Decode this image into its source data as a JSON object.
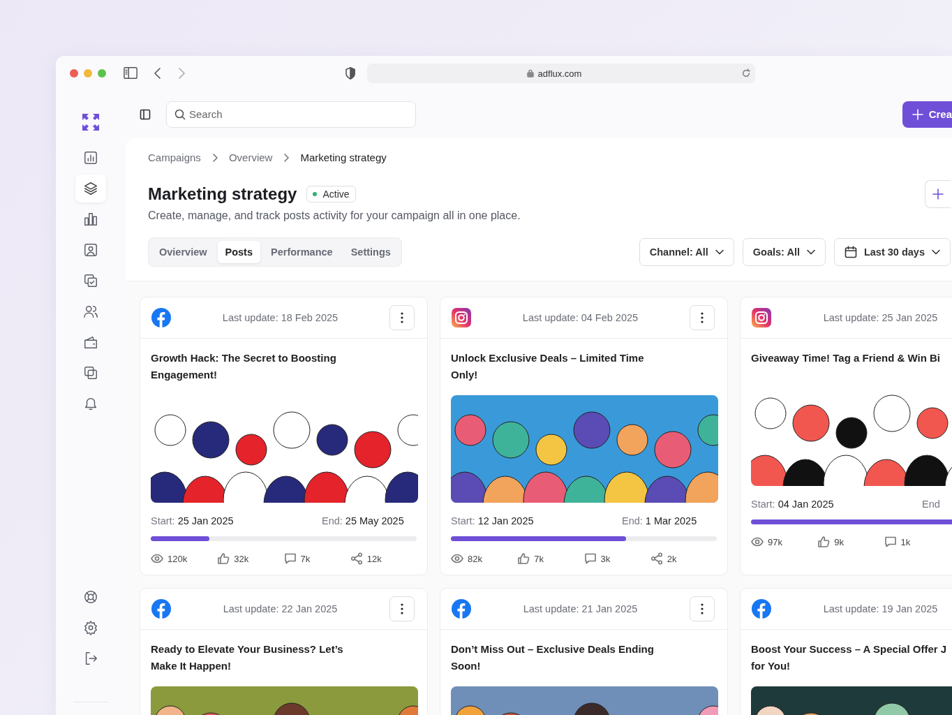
{
  "browser": {
    "url": "adflux.com"
  },
  "nav_items": [
    {
      "selected": false
    },
    {
      "selected": true
    },
    {
      "selected": false
    },
    {
      "selected": false
    },
    {
      "selected": false
    },
    {
      "selected": false
    },
    {
      "selected": false
    },
    {
      "selected": false
    },
    {
      "selected": false
    }
  ],
  "nav_bottom": [
    {
      "selected": false
    },
    {
      "selected": false
    },
    {
      "selected": false
    }
  ],
  "search": {
    "placeholder": "Search"
  },
  "create_button": "Crea",
  "breadcrumb": [
    "Campaigns",
    "Overview",
    "Marketing strategy"
  ],
  "page": {
    "title": "Marketing strategy",
    "status": "Active",
    "subtitle": "Create, manage, and track posts activity for your campaign all in one place."
  },
  "tabs": [
    {
      "label": "Ovierview",
      "selected": false
    },
    {
      "label": "Posts",
      "selected": true
    },
    {
      "label": "Performance",
      "selected": false
    },
    {
      "label": "Settings",
      "selected": false
    }
  ],
  "filters": [
    {
      "label": "Channel: All",
      "kind": "dropdown"
    },
    {
      "label": "Goals: All",
      "kind": "dropdown"
    },
    {
      "label": "Last 30 days",
      "kind": "date"
    }
  ],
  "cards": [
    {
      "kind": "facebook",
      "updated": "Last update: 18 Feb 2025",
      "menu": true,
      "title_lines": [
        "Growth Hack: The Secret to Boosting",
        "Engagement!"
      ],
      "start_label": "Start:",
      "start": "25 Jan 2025",
      "end_label": "End:",
      "end": "25 May 2025",
      "level": 0.22,
      "stats": [
        {
          "kind": "views",
          "value": "120k"
        },
        {
          "kind": "likes",
          "value": "32k"
        },
        {
          "kind": "comments",
          "value": "7k"
        },
        {
          "kind": "shares",
          "value": "12k"
        }
      ]
    },
    {
      "kind": "instagram",
      "updated": "Last update: 04 Feb 2025",
      "menu": true,
      "title_lines": [
        "Unlock Exclusive Deals – Limited Time",
        "Only!"
      ],
      "start_label": "Start:",
      "start": "12 Jan 2025",
      "end_label": "End:",
      "end": "1 Mar 2025",
      "level": 0.66,
      "stats": [
        {
          "kind": "views",
          "value": "82k"
        },
        {
          "kind": "likes",
          "value": "7k"
        },
        {
          "kind": "comments",
          "value": "3k"
        },
        {
          "kind": "shares",
          "value": "2k"
        }
      ]
    },
    {
      "kind": "instagram",
      "updated": "Last update: 25 Jan 2025",
      "menu": false,
      "title_lines": [
        "Giveaway Time! Tag a Friend & Win Bi"
      ],
      "start_label": "Start:",
      "start": "04 Jan 2025",
      "end_label": "End",
      "level": 0.9,
      "stats": [
        {
          "kind": "views",
          "value": "97k"
        },
        {
          "kind": "likes",
          "value": "9k"
        },
        {
          "kind": "comments",
          "value": "1k"
        }
      ]
    },
    {
      "kind": "facebook",
      "updated": "Last update: 22 Jan 2025",
      "menu": true,
      "title_lines": [
        "Ready to Elevate Your Business? Let’s",
        "Make It Happen!"
      ]
    },
    {
      "kind": "facebook",
      "updated": "Last update: 21 Jan 2025",
      "menu": true,
      "title_lines": [
        "Don’t Miss Out – Exclusive Deals Ending",
        "Soon!"
      ]
    },
    {
      "kind": "facebook",
      "updated": "Last update: 19 Jan 2025",
      "menu": false,
      "title_lines": [
        "Boost Your Success – A Special Offer J",
        "for You!"
      ]
    }
  ]
}
